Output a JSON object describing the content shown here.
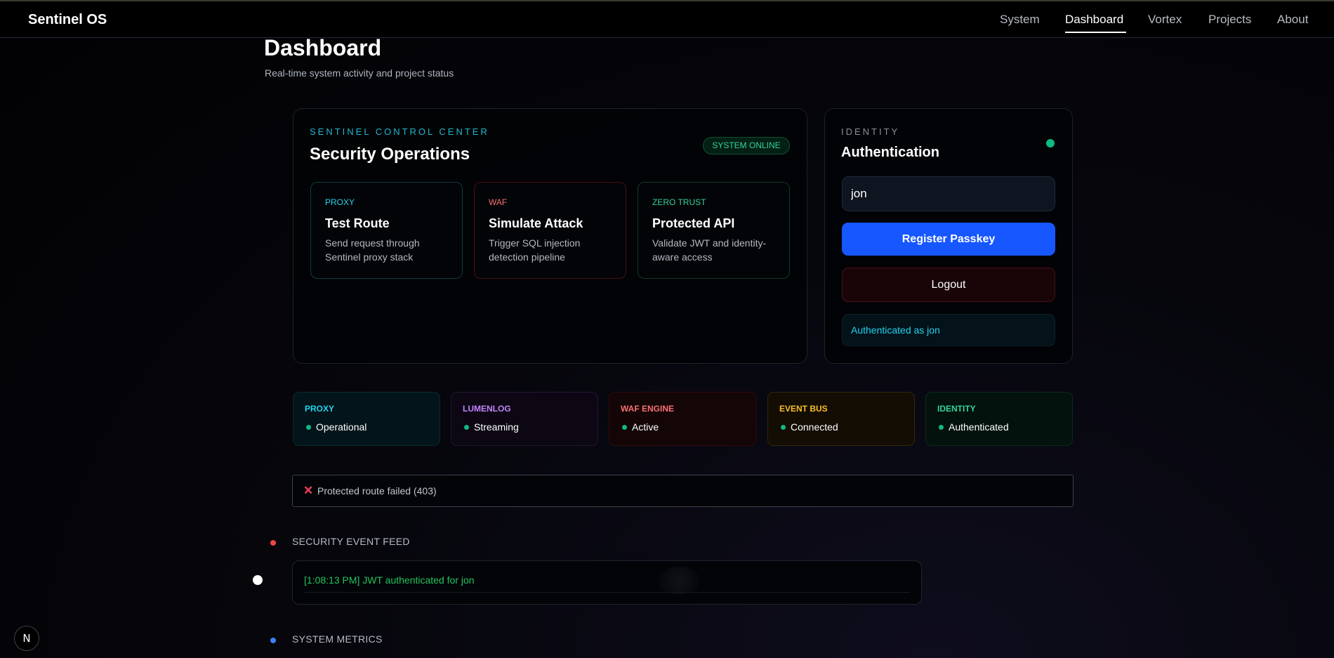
{
  "app": {
    "brand": "Sentinel OS"
  },
  "nav": {
    "items": [
      {
        "label": "System"
      },
      {
        "label": "Dashboard",
        "active": true
      },
      {
        "label": "Vortex"
      },
      {
        "label": "Projects"
      },
      {
        "label": "About"
      }
    ]
  },
  "page": {
    "title": "Dashboard",
    "subtitle": "Real-time system activity and project status"
  },
  "control_center": {
    "eyebrow": "SENTINEL CONTROL CENTER",
    "title": "Security Operations",
    "badge": "SYSTEM ONLINE",
    "actions": [
      {
        "label": "PROXY",
        "title": "Test Route",
        "description": "Send request through Sentinel proxy stack",
        "color": "#22d3ee",
        "border": "#0e3b44"
      },
      {
        "label": "WAF",
        "title": "Simulate Attack",
        "description": "Trigger SQL injection detection pipeline",
        "color": "#f87171",
        "border": "#4a0d15"
      },
      {
        "label": "ZERO TRUST",
        "title": "Protected API",
        "description": "Validate JWT and identity-aware access",
        "color": "#34d399",
        "border": "#0d3a2a"
      }
    ]
  },
  "identity": {
    "eyebrow": "IDENTITY",
    "title": "Authentication",
    "username_value": "jon",
    "register_label": "Register Passkey",
    "logout_label": "Logout",
    "status": "Authenticated as jon",
    "indicator_color": "#10b981"
  },
  "services": [
    {
      "label": "PROXY",
      "status": "Operational",
      "color": "#22d3ee",
      "bg": "#03141a",
      "border": "#0a2a31"
    },
    {
      "label": "LUMENLOG",
      "status": "Streaming",
      "color": "#c084fc",
      "bg": "#0d0714",
      "border": "#241433"
    },
    {
      "label": "WAF ENGINE",
      "status": "Active",
      "color": "#f87171",
      "bg": "#140506",
      "border": "#330b10"
    },
    {
      "label": "EVENT BUS",
      "status": "Connected",
      "color": "#fbbf24",
      "bg": "#130d03",
      "border": "#33260a"
    },
    {
      "label": "IDENTITY",
      "status": "Authenticated",
      "color": "#34d399",
      "bg": "#03120c",
      "border": "#0a2b1f"
    }
  ],
  "error": {
    "icon": "cross-mark-icon",
    "message": "Protected route failed (403)"
  },
  "feed": {
    "title": "SECURITY EVENT FEED",
    "dot_color": "#ef4444",
    "entries": [
      "[1:08:13 PM] JWT authenticated for jon"
    ]
  },
  "metrics": {
    "title": "SYSTEM METRICS",
    "dot_color": "#3b82f6"
  },
  "dev_badge": {
    "label": "N"
  }
}
